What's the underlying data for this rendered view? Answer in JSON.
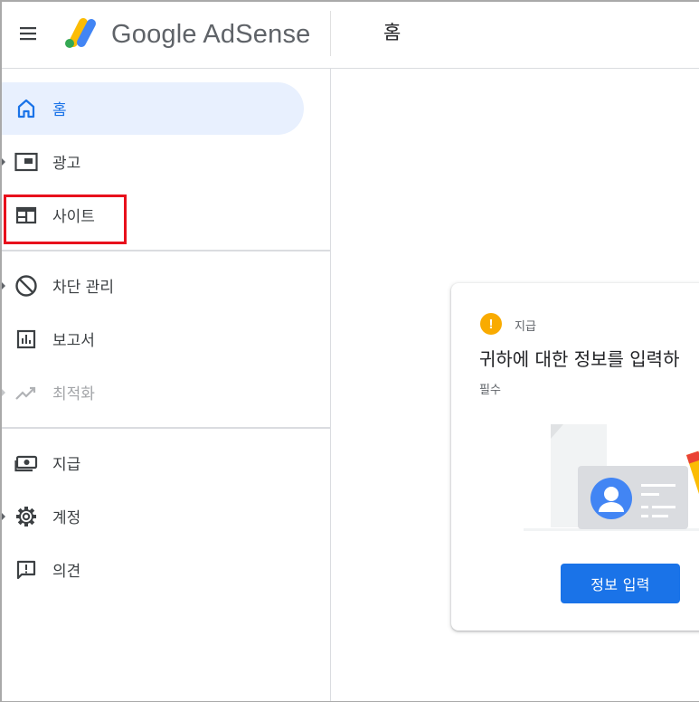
{
  "header": {
    "brand": "Google AdSense",
    "page_title": "홈",
    "logo_colors": [
      "#fbbc04",
      "#4285f4",
      "#34a853"
    ]
  },
  "sidebar": {
    "items": [
      {
        "label": "홈",
        "icon": "home-icon",
        "active": true
      },
      {
        "label": "광고",
        "icon": "ads-icon",
        "expandable": true
      },
      {
        "label": "사이트",
        "icon": "sites-icon",
        "highlighted": true
      },
      {
        "label": "차단 관리",
        "icon": "block-icon",
        "expandable": true
      },
      {
        "label": "보고서",
        "icon": "reports-icon"
      },
      {
        "label": "최적화",
        "icon": "optimization-icon",
        "expandable": true,
        "disabled": true
      },
      {
        "label": "지급",
        "icon": "payments-icon"
      },
      {
        "label": "계정",
        "icon": "settings-gear-icon",
        "expandable": true
      },
      {
        "label": "의견",
        "icon": "feedback-icon"
      }
    ]
  },
  "card": {
    "category": "지급",
    "title": "귀하에 대한 정보를 입력하",
    "required": "필수",
    "button": "정보 입력"
  },
  "colors": {
    "accent": "#1a73e8",
    "active_bg": "#e8f0fe",
    "warning": "#f9ab00",
    "highlight_border": "#e8101c"
  }
}
